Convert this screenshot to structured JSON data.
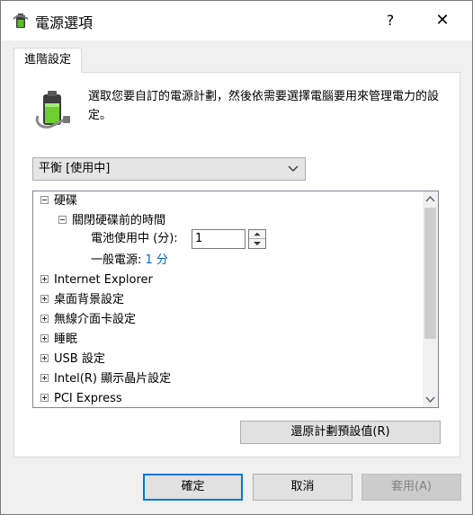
{
  "window": {
    "title": "電源選項",
    "help_label": "?",
    "close_label": "✕"
  },
  "tab": {
    "label": "進階設定"
  },
  "description": "選取您要自訂的電源計劃，然後依需要選擇電腦要用來管理電力的設定。",
  "plan_select": {
    "selected": "平衡 [使用中]"
  },
  "tree": {
    "hard_disk": "硬碟",
    "turn_off_disk": "關閉硬碟前的時間",
    "on_battery_label": "電池使用中 (分):",
    "on_battery_value": "1",
    "plugged_in_label": "一般電源:",
    "plugged_in_value": "1 分",
    "items": [
      "Internet Explorer",
      "桌面背景設定",
      "無線介面卡設定",
      "睡眠",
      "USB 設定",
      "Intel(R) 顯示晶片設定",
      "PCI Express"
    ]
  },
  "buttons": {
    "restore": "還原計劃預設值(R)",
    "ok": "確定",
    "cancel": "取消",
    "apply": "套用(A)"
  },
  "colors": {
    "accent": "#0078d7",
    "link": "#0066cc"
  },
  "icons": {
    "title": "battery-power-icon",
    "panel": "battery-plan-icon"
  }
}
